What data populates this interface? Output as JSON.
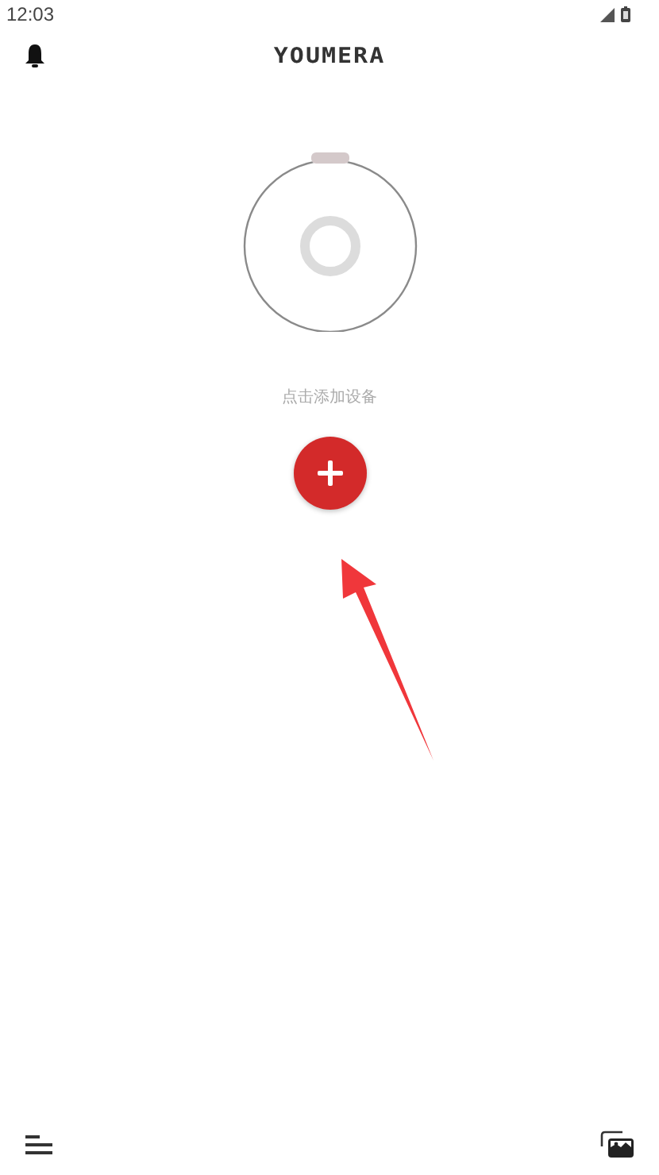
{
  "status_bar": {
    "time": "12:03"
  },
  "header": {
    "logo": "YOUMERA"
  },
  "device": {
    "caption": "点击添加设备"
  }
}
